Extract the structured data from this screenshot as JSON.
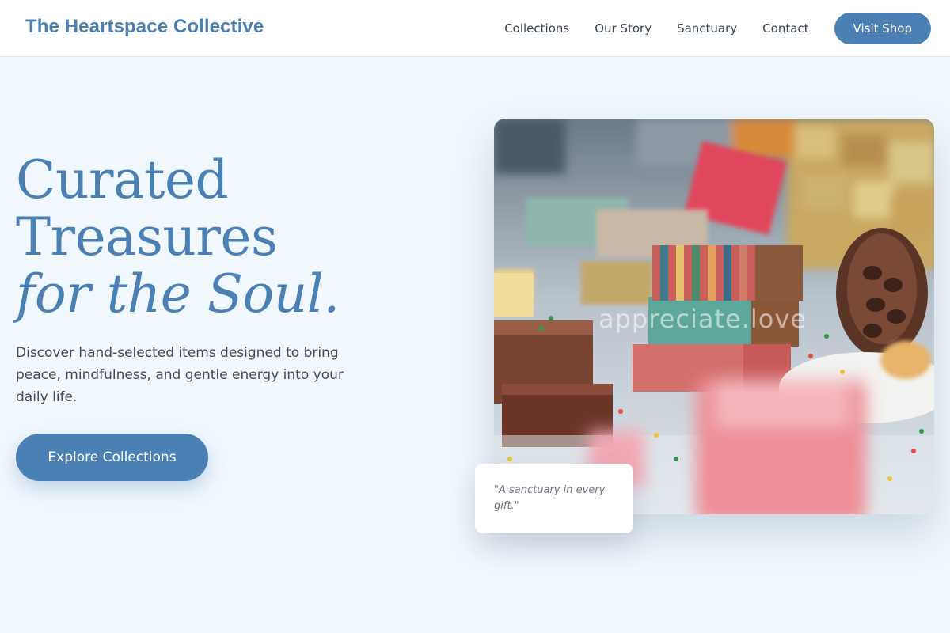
{
  "header": {
    "brand": "The Heartspace Collective",
    "nav": [
      {
        "label": "Collections"
      },
      {
        "label": "Our Story"
      },
      {
        "label": "Sanctuary"
      },
      {
        "label": "Contact"
      }
    ],
    "cta_label": "Visit Shop"
  },
  "hero": {
    "title_line1": "Curated",
    "title_line2": "Treasures",
    "title_line3": "for the Soul.",
    "description": "Discover hand-selected items designed to bring peace, mindfulness, and gentle energy into your daily life.",
    "button_label": "Explore Collections",
    "image_watermark": "appreciate.love",
    "quote": "\"A sanctuary in every gift.\""
  },
  "colors": {
    "accent": "#4a80b4",
    "background": "#f0f7fd",
    "header_bg": "#ffffff"
  }
}
